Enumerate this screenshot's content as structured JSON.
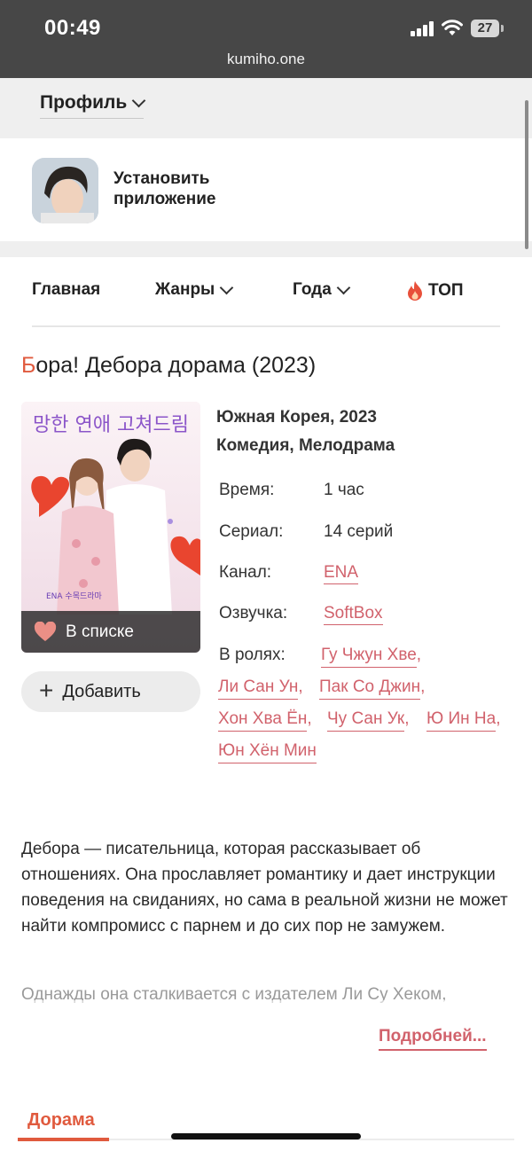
{
  "status_bar": {
    "time": "00:49",
    "url": "kumiho.one",
    "battery": "27"
  },
  "profile": {
    "label": "Профиль"
  },
  "install": {
    "label": "Установить приложение"
  },
  "nav": {
    "home": "Главная",
    "genres": "Жанры",
    "years": "Года",
    "top": "ТОП"
  },
  "title": {
    "first_letter": "Б",
    "rest": "ора! Дебора дорама (2023)"
  },
  "poster": {
    "korean_title": "망한 연애 고쳐드림",
    "in_list_label": "В списке"
  },
  "add_button": {
    "label": "Добавить"
  },
  "info": {
    "country_year": "Южная Корея, 2023",
    "genres": "Комедия, Мелодрама",
    "rows": [
      {
        "label": "Время:",
        "value": "1 час"
      },
      {
        "label": "Сериал:",
        "value": "14 серий"
      },
      {
        "label": "Канал:",
        "value": "ENA"
      },
      {
        "label": "Озвучка:",
        "value": "SoftBox"
      }
    ],
    "cast_label": "В ролях:",
    "cast": [
      "Гу Чжун Хве",
      "Ли Сан Ун",
      "Пак Со Джин",
      "Хон Хва Ён",
      "Чу Сан Ук",
      "Ю Ин На",
      "Юн Хён Мин"
    ]
  },
  "description": {
    "paragraph1": "Дебора — писательница, которая рассказывает об отношениях. Она прославляет романтику и дает инструкции поведения на свиданиях, но сама в реальной жизни не может найти компромисс с парнем и до сих пор не замужем.",
    "paragraph2": "Однажды она сталкивается с издателем Ли Су Хеком,",
    "more": "Подробней..."
  },
  "tabs": {
    "active": "Дорама"
  },
  "colors": {
    "accent": "#e05a3e",
    "link": "#d1626c",
    "status_bar": "#474747"
  }
}
